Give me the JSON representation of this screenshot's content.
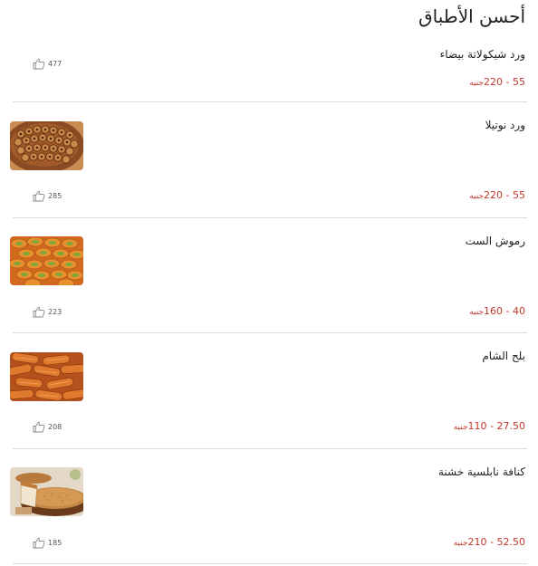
{
  "section_title": "أحسن الأطباق",
  "currency": "جنيه",
  "dishes": [
    {
      "name": "ورد شيكولاتة بيضاء",
      "price": "55 - 220",
      "likes": "477",
      "image": "none"
    },
    {
      "name": "ورد نوتيلا",
      "price": "55 - 220",
      "likes": "285",
      "image": "nutella-roses-tray"
    },
    {
      "name": "رموش الست",
      "price": "40 - 160",
      "likes": "223",
      "image": "pistachio-pastries"
    },
    {
      "name": "بلح الشام",
      "price": "27.50 - 110",
      "likes": "208",
      "image": "fried-churros"
    },
    {
      "name": "كنافة نابلسية خشنة",
      "price": "52.50 - 210",
      "likes": "185",
      "image": "knafeh-plate"
    }
  ],
  "icons": {
    "likes": "thumbs-up-icon"
  },
  "colors": {
    "price": "#c0392b",
    "divider": "#dcdcdc",
    "text": "#222222"
  }
}
